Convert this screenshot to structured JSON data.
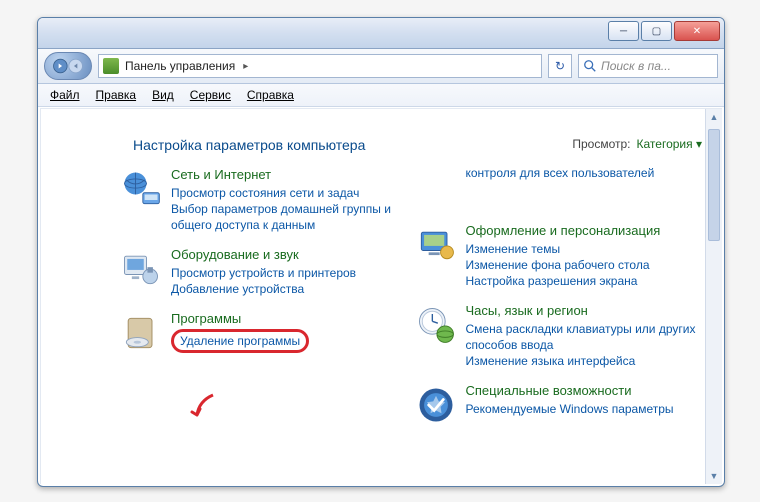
{
  "titlebar": {
    "min_glyph": "─",
    "max_glyph": "▢",
    "close_glyph": "✕"
  },
  "navbar": {
    "address_text": "Панель управления",
    "breadcrumb_arrow": "▸",
    "refresh_glyph": "↻",
    "search_placeholder": "Поиск в па..."
  },
  "menubar": {
    "file": "Файл",
    "edit": "Правка",
    "view": "Вид",
    "tools": "Сервис",
    "help": "Справка"
  },
  "content": {
    "heading": "Настройка параметров компьютера",
    "view_by_label": "Просмотр:",
    "view_by_value": "Категория",
    "view_by_arrow": "▾"
  },
  "left_cats": [
    {
      "title": "Сеть и Интернет",
      "links": [
        "Просмотр состояния сети и задач",
        "Выбор параметров домашней группы и общего доступа к данным"
      ]
    },
    {
      "title": "Оборудование и звук",
      "links": [
        "Просмотр устройств и принтеров",
        "Добавление устройства"
      ]
    },
    {
      "title": "Программы",
      "links": [
        "Удаление программы"
      ]
    }
  ],
  "right_cats": [
    {
      "title": "",
      "links": [
        "контроля для всех пользователей"
      ]
    },
    {
      "title": "Оформление и персонализация",
      "links": [
        "Изменение темы",
        "Изменение фона рабочего стола",
        "Настройка разрешения экрана"
      ]
    },
    {
      "title": "Часы, язык и регион",
      "links": [
        "Смена раскладки клавиатуры или других способов ввода",
        "Изменение языка интерфейса"
      ]
    },
    {
      "title": "Специальные возможности",
      "links": [
        "Рекомендуемые Windows параметры"
      ]
    }
  ]
}
